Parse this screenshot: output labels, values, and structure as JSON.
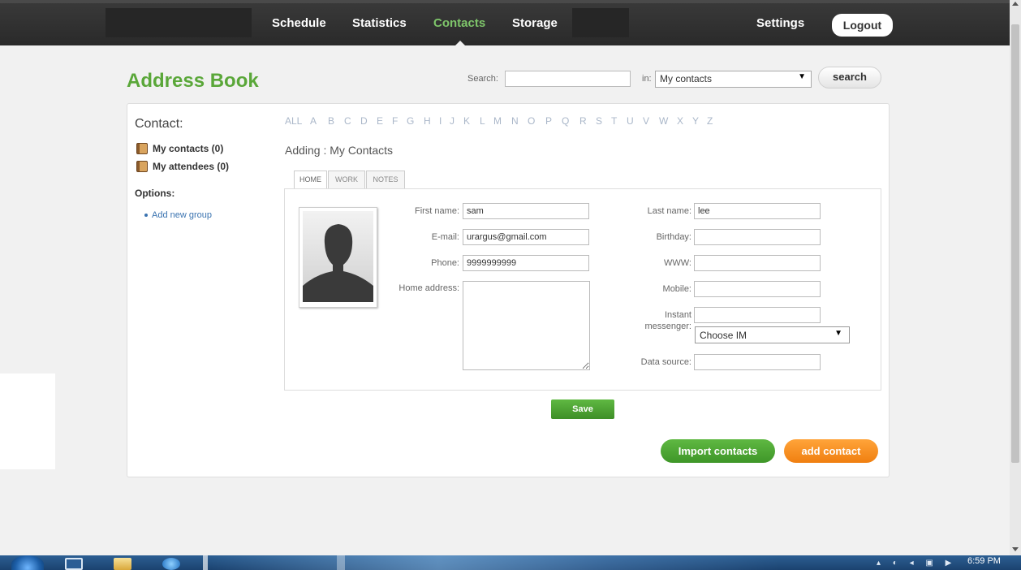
{
  "nav": {
    "items": [
      {
        "label": "Schedule"
      },
      {
        "label": "Statistics"
      },
      {
        "label": "Contacts"
      },
      {
        "label": "Storage"
      }
    ],
    "settings": "Settings",
    "logout": "Logout",
    "active": "Contacts",
    "active_color": "#7ec56a"
  },
  "header": {
    "title": "Address Book",
    "title_color": "#5aa739",
    "search_label": "Search:",
    "search_value": "",
    "in_label": "in:",
    "in_value": "My contacts",
    "search_button": "search"
  },
  "sidebar": {
    "heading": "Contact:",
    "groups": [
      {
        "label": "My contacts (0)",
        "icon": "address-book-icon"
      },
      {
        "label": "My attendees (0)",
        "icon": "address-book-icon"
      }
    ],
    "options_heading": "Options:",
    "options": [
      {
        "label": "Add new group"
      }
    ]
  },
  "alphabet": [
    "ALL",
    "A",
    "B",
    "C",
    "D",
    "E",
    "F",
    "G",
    "H",
    "I",
    "J",
    "K",
    "L",
    "M",
    "N",
    "O",
    "P",
    "Q",
    "R",
    "S",
    "T",
    "U",
    "V",
    "W",
    "X",
    "Y",
    "Z"
  ],
  "form": {
    "title": "Adding : My Contacts",
    "tabs": [
      {
        "label": "HOME",
        "active": true
      },
      {
        "label": "WORK",
        "active": false
      },
      {
        "label": "NOTES",
        "active": false
      }
    ],
    "fields": {
      "first_name": {
        "label": "First name:",
        "value": "sam"
      },
      "email": {
        "label": "E-mail:",
        "value": "urargus@gmail.com"
      },
      "phone": {
        "label": "Phone:",
        "value": "9999999999"
      },
      "home_address": {
        "label": "Home address:",
        "value": ""
      },
      "last_name": {
        "label": "Last name:",
        "value": "lee"
      },
      "birthday": {
        "label": "Birthday:",
        "value": ""
      },
      "www": {
        "label": "WWW:",
        "value": ""
      },
      "mobile": {
        "label": "Mobile:",
        "value": ""
      },
      "instant_messenger": {
        "label_line1": "Instant",
        "label_line2": "messenger:",
        "value": "",
        "select_value": "Choose IM"
      },
      "data_source": {
        "label": "Data source:",
        "value": ""
      }
    },
    "save": "Save"
  },
  "actions": {
    "import": "Import contacts",
    "add": "add contact",
    "import_color": "#4aa531",
    "add_color": "#f5901f"
  },
  "taskbar": {
    "clock": "6:59 PM"
  }
}
